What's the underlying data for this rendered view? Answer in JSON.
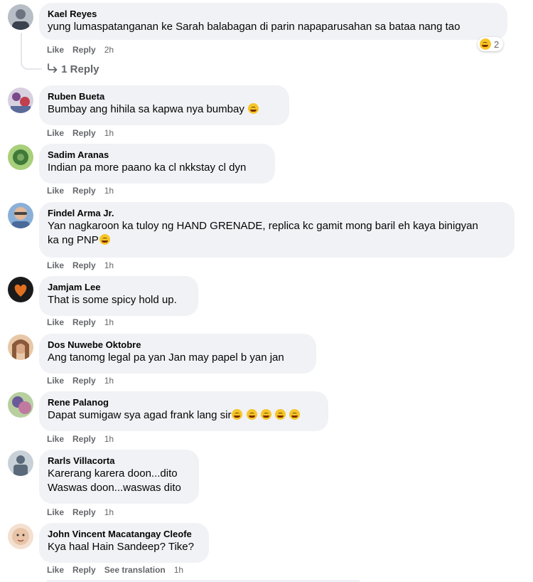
{
  "comments": [
    {
      "author": "Kael Reyes",
      "text": "yung lumaspatanganan ke Sarah balabagan di parin napaparusahan sa bataa nang tao",
      "actions": [
        "Like",
        "Reply"
      ],
      "time": "2h",
      "reaction_count": "2",
      "avatar_colors": [
        "#6d7380",
        "#c2c6cc"
      ]
    },
    {
      "author": "Ruben Bueta",
      "text": "Bumbay ang hihila sa kapwa nya bumbay",
      "actions": [
        "Like",
        "Reply"
      ],
      "time": "1h",
      "avatar_colors": [
        "#7a4a8a",
        "#d8d0e0"
      ]
    },
    {
      "author": "Sadim Aranas",
      "text": "Indian pa more paano ka cl nkkstay cl dyn",
      "actions": [
        "Like",
        "Reply"
      ],
      "time": "1h",
      "avatar_colors": [
        "#3f7a3a",
        "#a8cf7a"
      ]
    },
    {
      "author": "Findel Arma Jr.",
      "text": "Yan nagkaroon ka tuloy ng HAND GRENADE, replica kc gamit mong baril eh kaya binigyan ka ng PNP",
      "actions": [
        "Like",
        "Reply"
      ],
      "time": "1h",
      "avatar_colors": [
        "#4a6a9a",
        "#e2b89a"
      ]
    },
    {
      "author": "Jamjam Lee",
      "text": "That is some spicy hold up.",
      "actions": [
        "Like",
        "Reply"
      ],
      "time": "1h",
      "avatar_colors": [
        "#1a1a1a",
        "#e07020"
      ]
    },
    {
      "author": "Dos Nuwebe Oktobre",
      "text": "Ang tanomg legal pa yan Jan may papel b yan jan",
      "actions": [
        "Like",
        "Reply"
      ],
      "time": "1h",
      "avatar_colors": [
        "#8a5a3a",
        "#e8c8a8"
      ]
    },
    {
      "author": "Rene Palanog",
      "text": "Dapat sumigaw sya agad frank lang sir",
      "actions": [
        "Like",
        "Reply"
      ],
      "time": "1h",
      "avatar_colors": [
        "#6a5a9a",
        "#b8d0a0"
      ]
    },
    {
      "author": "Rarls Villacorta",
      "text_lines": [
        "Karerang karera doon...dito",
        "Waswas doon...waswas dito"
      ],
      "actions": [
        "Like",
        "Reply"
      ],
      "time": "1h",
      "avatar_colors": [
        "#5a6a7a",
        "#c8d0d8"
      ]
    },
    {
      "author": "John Vincent Macatangay Cleofe",
      "text": "Kya haal Hain Sandeep? Tike?",
      "actions": [
        "Like",
        "Reply",
        "See translation"
      ],
      "time": "1h",
      "avatar_colors": [
        "#c89a7a",
        "#f4e0d0"
      ]
    }
  ],
  "replies_link": "1 Reply",
  "colors": {
    "bubble": "#f0f2f5",
    "secondary_text": "#65676b",
    "primary_text": "#050505",
    "emoji": "#f7c528"
  },
  "icons": {
    "reply_arrow": "reply-arrow-icon",
    "laugh_emoji": "laughing-emoji-icon",
    "grin_emoji": "grinning-emoji-icon"
  }
}
